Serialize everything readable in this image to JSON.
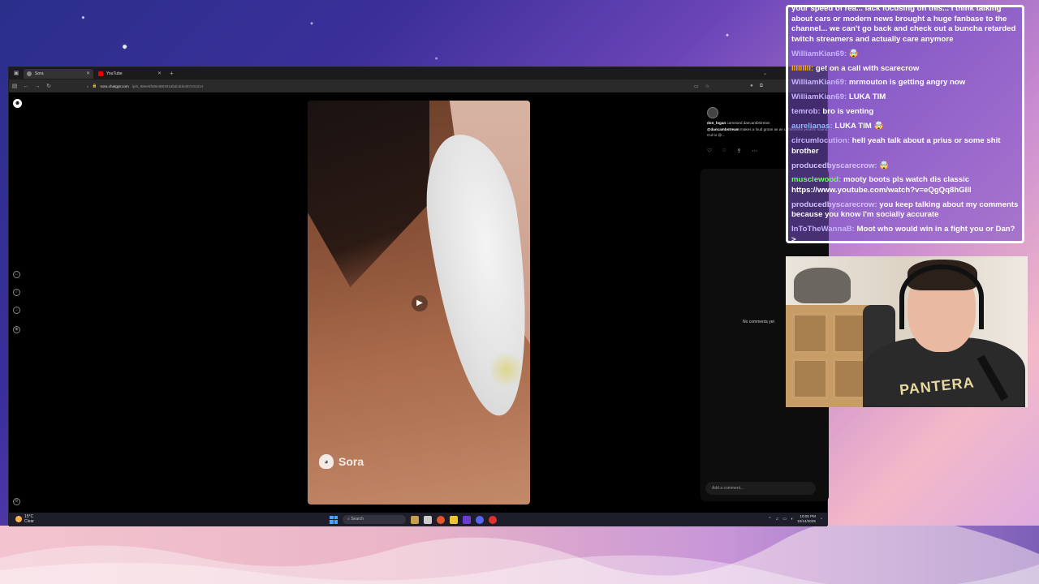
{
  "browser": {
    "tabs": [
      {
        "label": "Sora",
        "active": true
      },
      {
        "label": "YouTube",
        "active": false
      }
    ],
    "new_tab": "+",
    "url_host": "sora.chatgpt.com",
    "url_path": "/p/s_68ee5f48e488191abdcdde457c01214"
  },
  "video": {
    "watermark": "Sora",
    "play_icon": "play-icon"
  },
  "post": {
    "username": "don_logan",
    "cameo_text": "cameoed dancambstream",
    "mention": "@dancambstream",
    "caption": "makes a loud groan as an ughhhhhhh yeahhh sound. Cut to @..."
  },
  "comments": {
    "empty_text": "No comments yet",
    "placeholder": "Add a comment..."
  },
  "taskbar": {
    "temp": "15°C",
    "condition": "Clear",
    "search_label": "Search",
    "time": "10:06 PM",
    "date": "10/14/2025"
  },
  "chat": {
    "top_message": "your speed of rea... lack focusing on this... I think talking about cars or modern news brought a huge fanbase to the channel... we can't go back and check out a buncha retarded twitch streamers and actually care anymore",
    "messages": [
      {
        "user": "WilliamKian69",
        "text": "🤯",
        "color": "#c9b3ff"
      },
      {
        "user": "lllllllll",
        "text": "get on a call with scarecrow",
        "color": "#ffb000"
      },
      {
        "user": "WilliamKian69",
        "text": "mrmouton is getting angry now",
        "color": "#c9b3ff"
      },
      {
        "user": "WilliamKian69",
        "text": "LUKA TIM",
        "color": "#c9b3ff"
      },
      {
        "user": "temrob",
        "text": "bro is venting",
        "color": "#c9b3ff"
      },
      {
        "user": "aurelianas",
        "text": "LUKA TIM 🤯",
        "color": "#8fb7ff"
      },
      {
        "user": "circumlocution",
        "text": "hell yeah talk about a prius or some shit brother",
        "color": "#c9b3ff"
      },
      {
        "user": "producedbyscarecrow",
        "text": "🤯",
        "color": "#d4c2ff"
      },
      {
        "user": "musclewood",
        "text": "mooty boots pls watch dis classic https://www.youtube.com/watch?v=eQgQq8hGIll",
        "color": "#6bff5a"
      },
      {
        "user": "producedbyscarecrow",
        "text": "you keep talking about my comments because you know I'm socially accurate",
        "color": "#d4c2ff"
      },
      {
        "user": "InToTheWannaB",
        "text": "Moot who would win in a fight you or Dan?>",
        "color": "#c9b3ff"
      }
    ]
  },
  "webcam": {
    "shirt_text": "PANTERA"
  }
}
